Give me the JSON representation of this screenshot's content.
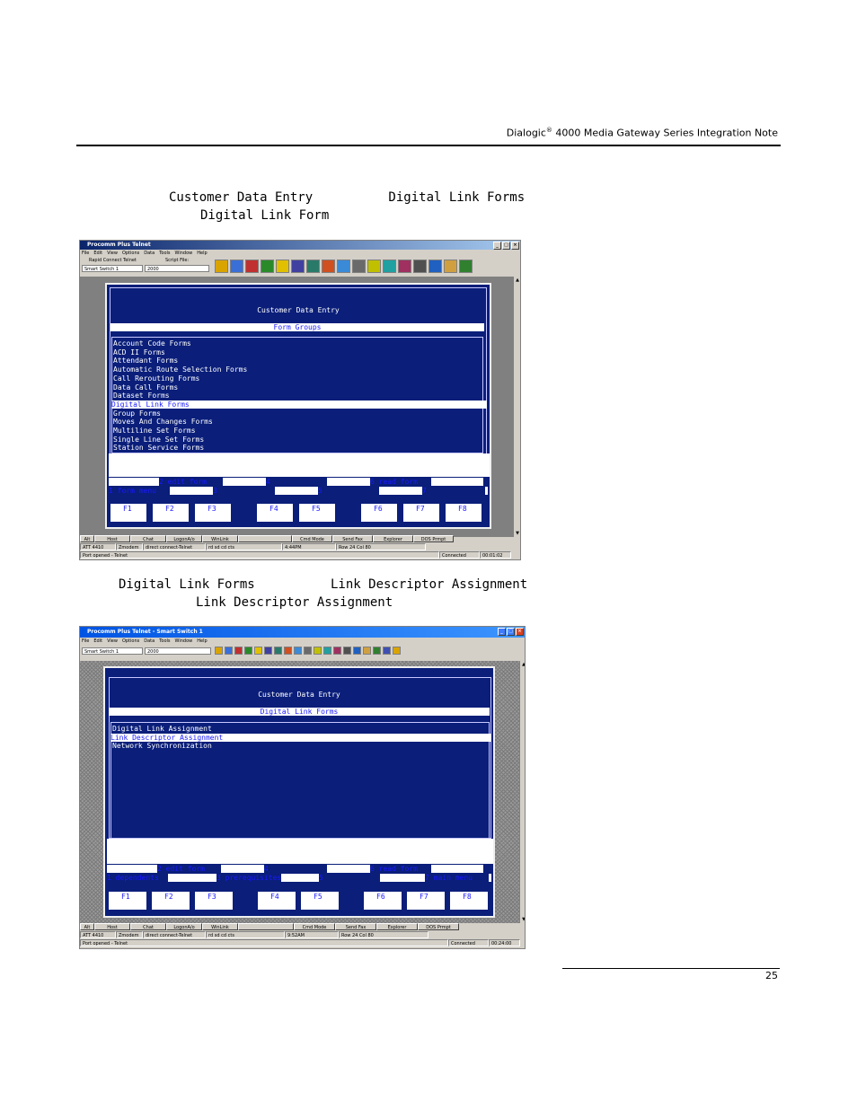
{
  "header": {
    "brand": "Dialogic",
    "reg": "®",
    "rest": " 4000 Media Gateway Series Integration Note"
  },
  "text1": {
    "line1": "Customer Data Entry          Digital Link Forms",
    "line2": "Digital Link Form"
  },
  "text2": {
    "line1": "Digital Link Forms          Link Descriptor Assignment",
    "line2": "Link Descriptor Assignment"
  },
  "page_number": "25",
  "screens": [
    {
      "window_title": "Procomm Plus Telnet",
      "menu": [
        "File",
        "Edit",
        "View",
        "Options",
        "Data",
        "Tools",
        "Window",
        "Help"
      ],
      "rapid_connect_label": "Rapid Connect Telnet",
      "script_file_label": "Script File:",
      "connection_value": "Smart Switch 1",
      "script_value": "2000",
      "screen_title": "Customer Data Entry",
      "group_title": "Form Groups",
      "items": [
        "Account Code Forms",
        "ACD II Forms",
        "Attendant Forms",
        "Automatic Route Selection Forms",
        "Call Rerouting Forms",
        "Data Call Forms",
        "Dataset Forms",
        "Digital Link Forms",
        "Group Forms",
        "Moves And Changes Forms",
        "Multiline Set Forms",
        "Single Line Set Forms",
        "Station Service Forms"
      ],
      "selected_index": 7,
      "soft_top": {
        "k2": "2 edit form",
        "k4": "4",
        "k6": "6 read form"
      },
      "soft_bottom": {
        "k1": "1 form menu",
        "k3": "3",
        "k5": "5",
        "k7": "7"
      },
      "fkeys": [
        "F1",
        "F2",
        "F3",
        "F4",
        "F5",
        "F6",
        "F7",
        "F8"
      ],
      "macros": [
        "Alt",
        "Host",
        "Chat",
        "LogonA/o",
        "WinLink",
        "",
        "Cmd Mode",
        "Send Fax",
        "Explorer",
        "DOS Prmpt"
      ],
      "status": {
        "emul": "ATT 4410",
        "proto": "Zmodem",
        "conn": "direct connect-Telnet",
        "leds": "rd  sd  cd  cts",
        "time": "4:44PM",
        "rowcol": "Row 24   Col 80",
        "state": "Connected",
        "elapsed": "00:01:02",
        "port": "Port opened - Telnet"
      }
    },
    {
      "window_title": "Procomm Plus Telnet - Smart Switch 1",
      "menu": [
        "File",
        "Edit",
        "View",
        "Options",
        "Data",
        "Tools",
        "Window",
        "Help"
      ],
      "connection_value": "Smart Switch 1",
      "script_value": "2000",
      "screen_title": "Customer Data Entry",
      "group_title": "Digital Link Forms",
      "items": [
        "Digital Link Assignment",
        "Link Descriptor Assignment",
        "Network Synchronization"
      ],
      "selected_index": 1,
      "soft_top": {
        "k2": "2 edit form",
        "k4": "4",
        "k6": "6 read form"
      },
      "soft_bottom": {
        "k1": "1 dependents",
        "k3": "3 prerequisites",
        "k5": "5",
        "k7": "7 main menu"
      },
      "fkeys": [
        "F1",
        "F2",
        "F3",
        "F4",
        "F5",
        "F6",
        "F7",
        "F8"
      ],
      "macros": [
        "Alt",
        "Host",
        "Chat",
        "LogonA/o",
        "WinLink",
        "",
        "Cmd Mode",
        "Send Fax",
        "Explorer",
        "DOS Prmpt"
      ],
      "status": {
        "emul": "ATT 4410",
        "proto": "Zmodem",
        "conn": "direct connect-Telnet",
        "leds": "rd  sd  cd  cts",
        "time": "9:52AM",
        "rowcol": "Row 24   Col 80",
        "state": "Connected",
        "elapsed": "00:24:00",
        "port": "Port opened - Telnet"
      }
    }
  ],
  "colors": {
    "terminal_blue": "#0a1e7a",
    "highlight_text": "#1a1aff",
    "title_active": "#0a246a"
  }
}
